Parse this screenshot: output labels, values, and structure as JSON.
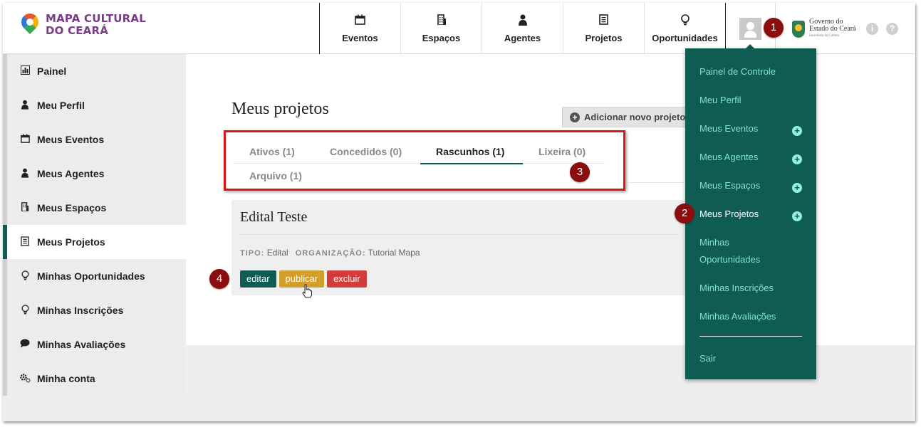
{
  "header": {
    "logo": {
      "line1": "MAPA CULTURAL",
      "line2": "DO CEARÁ"
    },
    "nav": [
      {
        "label": "Eventos",
        "icon": "calendar-icon"
      },
      {
        "label": "Espaços",
        "icon": "building-icon"
      },
      {
        "label": "Agentes",
        "icon": "person-icon"
      },
      {
        "label": "Projetos",
        "icon": "document-icon"
      },
      {
        "label": "Oportunidades",
        "icon": "lightbulb-icon"
      }
    ],
    "gov": {
      "line1": "Governo do",
      "line2": "Estado do Ceará",
      "line3": "Secretaria da Cultura"
    },
    "info_icon": "i",
    "help_icon": "?"
  },
  "sidebar": {
    "items": [
      {
        "label": "Painel",
        "icon": "chart-icon"
      },
      {
        "label": "Meu Perfil",
        "icon": "person-icon"
      },
      {
        "label": "Meus Eventos",
        "icon": "calendar-icon"
      },
      {
        "label": "Meus Agentes",
        "icon": "person-icon"
      },
      {
        "label": "Meus Espaços",
        "icon": "building-icon"
      },
      {
        "label": "Meus Projetos",
        "icon": "document-icon",
        "active": true
      },
      {
        "label": "Minhas Oportunidades",
        "icon": "lightbulb-icon"
      },
      {
        "label": "Minhas Inscrições",
        "icon": "lightbulb-icon"
      },
      {
        "label": "Minhas Avaliações",
        "icon": "speech-bubble-icon"
      },
      {
        "label": "Minha conta",
        "icon": "gears-icon"
      }
    ]
  },
  "main": {
    "title": "Meus projetos",
    "add_button": "Adicionar novo projeto",
    "tabs": [
      {
        "label": "Ativos (1)"
      },
      {
        "label": "Concedidos (0)"
      },
      {
        "label": "Rascunhos (1)",
        "active": true
      },
      {
        "label": "Lixeira (0)"
      },
      {
        "label": "Arquivo (1)"
      }
    ],
    "card": {
      "title": "Edital Teste",
      "tipo_key": "TIPO:",
      "tipo_value": "Edital",
      "org_key": "ORGANIZAÇÃO:",
      "org_value": "Tutorial Mapa",
      "edit": "editar",
      "publish": "publicar",
      "delete": "excluir"
    }
  },
  "dropdown": {
    "items": [
      {
        "label": "Painel de Controle"
      },
      {
        "label": "Meu Perfil"
      },
      {
        "label": "Meus Eventos",
        "plus": "+"
      },
      {
        "label": "Meus Agentes",
        "plus": "+"
      },
      {
        "label": "Meus Espaços",
        "plus": "+"
      },
      {
        "label": "Meus Projetos",
        "plus": "+",
        "current": true
      },
      {
        "label": "Minhas",
        "label2": "Oportunidades"
      },
      {
        "label": "Minhas Inscrições"
      },
      {
        "label": "Minhas Avaliações"
      }
    ],
    "logout": "Sair"
  },
  "badges": [
    "1",
    "2",
    "3",
    "4"
  ],
  "colors": {
    "primary": "#0f5d52",
    "highlight": "#e11414",
    "badge": "#8b0d0d",
    "publish": "#d2a02a",
    "delete": "#d43b3b"
  }
}
